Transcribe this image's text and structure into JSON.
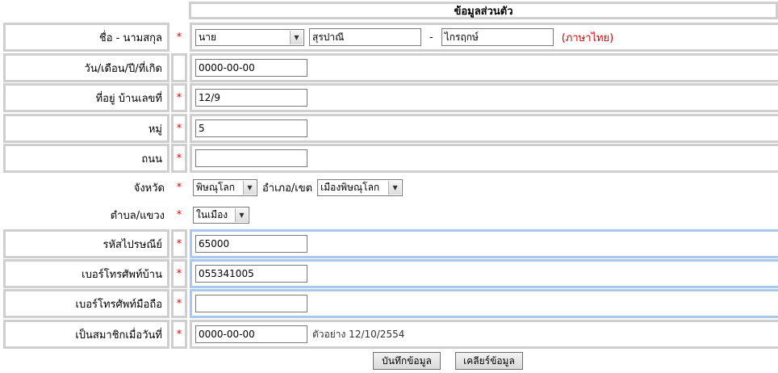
{
  "header": {
    "title": "ข้อมูลส่วนตัว"
  },
  "required_mark": "*",
  "name_row": {
    "label": "ชื่อ - นามสกุล",
    "title_value": "นาย",
    "first_name": "สุรปาณี",
    "separator": "-",
    "last_name": "ไกรฤกษ์",
    "language_note": "(ภาษาไทย)"
  },
  "birthdate_row": {
    "label": "วัน/เดือน/ปี/ที่เกิด",
    "value": "0000-00-00"
  },
  "address_row": {
    "label": "ที่อยู่ บ้านเลขที่",
    "value": "12/9"
  },
  "moo_row": {
    "label": "หมู่",
    "value": "5"
  },
  "road_row": {
    "label": "ถนน",
    "value": ""
  },
  "province_row": {
    "label": "จังหวัด",
    "province_value": "พิษณุโลก",
    "district_label": "อำเภอ/เขต",
    "district_value": "เมืองพิษณุโลก"
  },
  "subdistrict_row": {
    "label": "ตำบล/แขวง",
    "value": "ในเมือง"
  },
  "postcode_row": {
    "label": "รหัสไปรษณีย์",
    "value": "65000"
  },
  "home_phone_row": {
    "label": "เบอร์โทรศัพท์บ้าน",
    "value": "055341005"
  },
  "mobile_row": {
    "label": "เบอร์โทรศัพท์มือถือ",
    "value": ""
  },
  "member_since_row": {
    "label": "เป็นสมาชิกเมื่อวันที่",
    "value": "0000-00-00",
    "example": "ตัวอย่าง 12/10/2554"
  },
  "buttons": {
    "save": "บันทึกข้อมูล",
    "clear": "เคลียร์ข้อมูล"
  },
  "colors": {
    "required": "#e00000",
    "cell_border": "#cfcfcf",
    "highlight_border": "#a8c8ec"
  }
}
